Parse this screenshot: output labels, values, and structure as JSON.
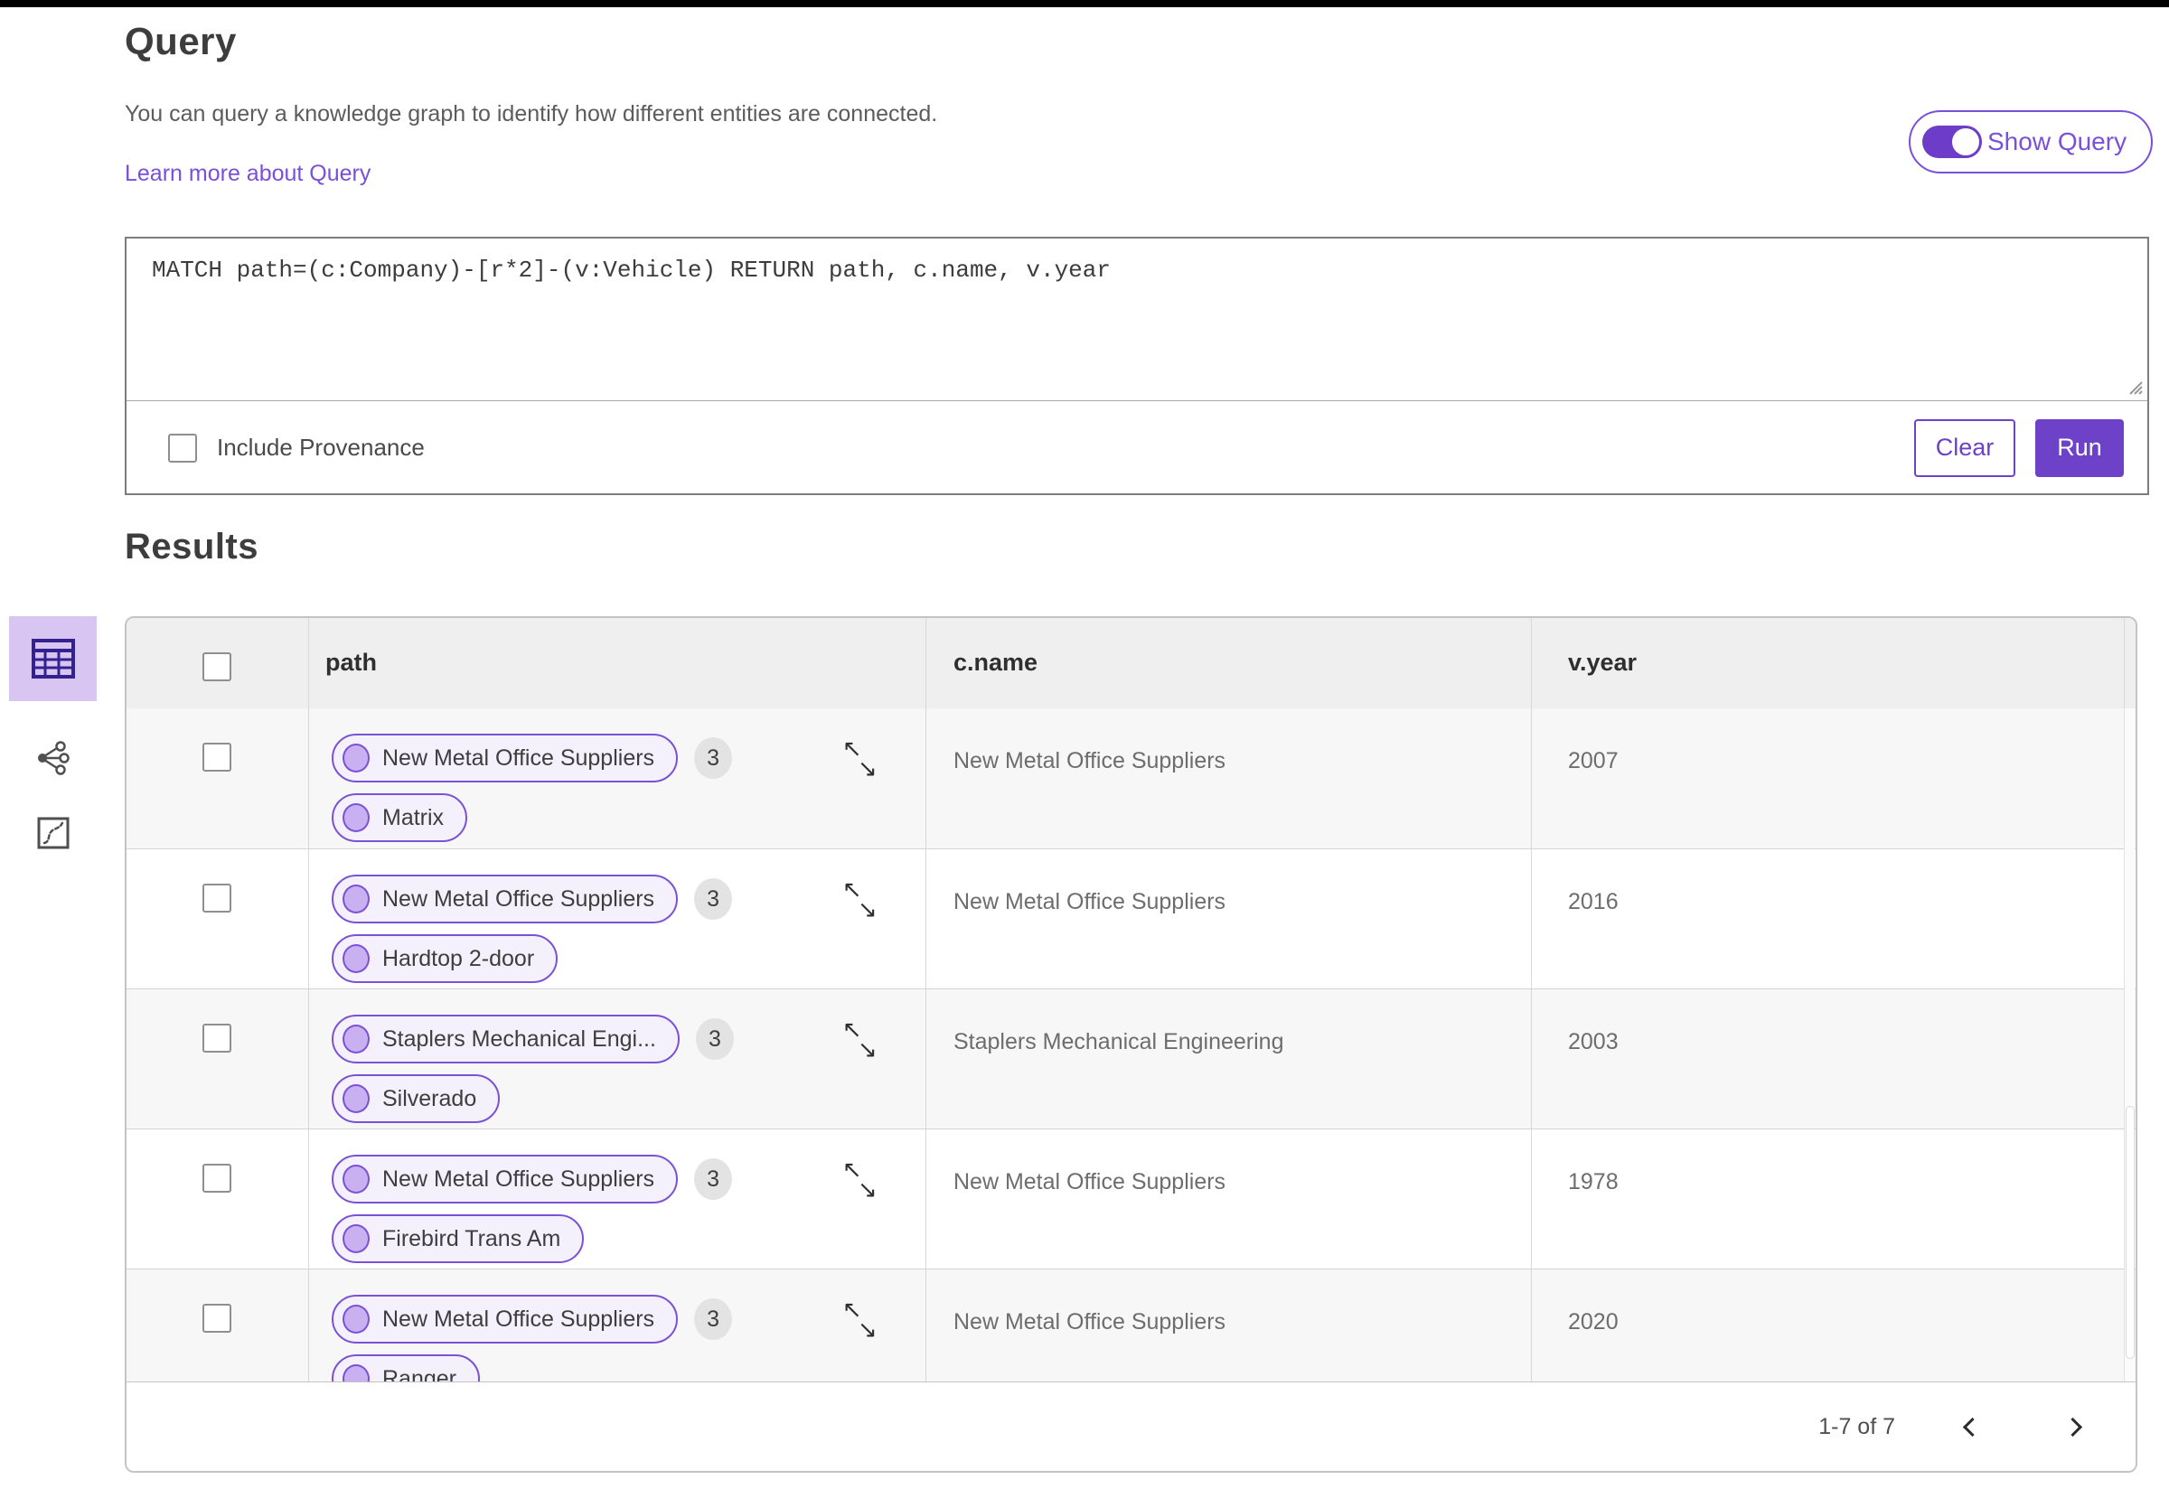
{
  "header": {
    "title": "Query",
    "description": "You can query a knowledge graph to identify how different entities are connected.",
    "learn_more_link": "Learn more about Query",
    "show_query": {
      "label": "Show Query",
      "state": "on"
    }
  },
  "query_editor": {
    "query_text": "MATCH path=(c:Company)-[r*2]-(v:Vehicle) RETURN path, c.name, v.year",
    "include_provenance": {
      "label": "Include Provenance",
      "checked": false
    },
    "buttons": {
      "clear": "Clear",
      "run": "Run"
    }
  },
  "results": {
    "title": "Results",
    "view_rail": [
      {
        "name": "table-view",
        "selected": true
      },
      {
        "name": "graph-view",
        "selected": false
      },
      {
        "name": "map-view",
        "selected": false
      }
    ],
    "table": {
      "columns": [
        "path",
        "c.name",
        "v.year"
      ],
      "rows": [
        {
          "pills": [
            "New Metal Office Suppliers",
            "Matrix"
          ],
          "count": "3",
          "c_name": "New Metal Office Suppliers",
          "v_year": "2007"
        },
        {
          "pills": [
            "New Metal Office Suppliers",
            "Hardtop 2-door"
          ],
          "count": "3",
          "c_name": "New Metal Office Suppliers",
          "v_year": "2016"
        },
        {
          "pills": [
            "Staplers Mechanical Engi...",
            "Silverado"
          ],
          "count": "3",
          "c_name": "Staplers Mechanical Engineering",
          "v_year": "2003"
        },
        {
          "pills": [
            "New Metal Office Suppliers",
            "Firebird Trans Am"
          ],
          "count": "3",
          "c_name": "New Metal Office Suppliers",
          "v_year": "1978"
        },
        {
          "pills": [
            "New Metal Office Suppliers",
            "Ranger"
          ],
          "count": "3",
          "c_name": "New Metal Office Suppliers",
          "v_year": "2020"
        }
      ],
      "pagination": {
        "range": "1-7 of 7"
      }
    }
  },
  "icons": {
    "expand_nw": "↖",
    "expand_se": "↘",
    "toggle": "toggle-on-icon",
    "prev": "chevron-left-icon",
    "next": "chevron-right-icon",
    "view_rail": [
      "table-icon",
      "graph-share-icon",
      "map-route-icon"
    ],
    "resize": "textarea-resize-grip"
  },
  "colors": {
    "accent": "#6d41c8",
    "accent_light": "#7a52d6",
    "pill_bg": "#f5f1fc",
    "node_fill": "#c9b0f0",
    "selected_tile_bg": "#d8c5f2",
    "table_icon": "#33218f",
    "header_bg": "#efefef",
    "row_alt_bg": "#f7f7f7"
  }
}
